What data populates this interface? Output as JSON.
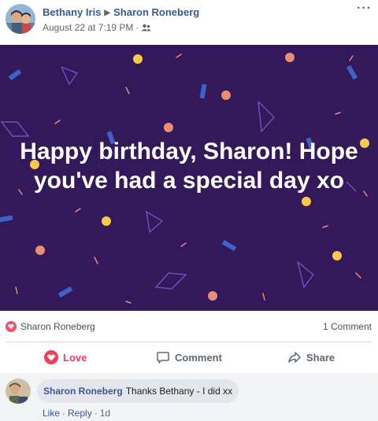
{
  "post": {
    "author": "Bethany Iris",
    "recipient": "Sharon Roneberg",
    "timestamp": "August 22 at 7:19 PM",
    "audience_icon": "friends-icon",
    "more_glyph": "···"
  },
  "banner": {
    "message": "Happy birthday, Sharon! Hope you've had a special day xo",
    "background": "#33195a"
  },
  "reactions": {
    "reactors": "Sharon Roneberg",
    "comment_count": "1 Comment"
  },
  "actions": {
    "love_label": "Love",
    "comment_label": "Comment",
    "share_label": "Share"
  },
  "comment": {
    "author": "Sharon Roneberg",
    "text": "Thanks Bethany - I did xx",
    "like_label": "Like",
    "reply_label": "Reply",
    "age": "1d"
  },
  "colors": {
    "link": "#385898",
    "love": "#f33e58",
    "muted": "#606770"
  }
}
